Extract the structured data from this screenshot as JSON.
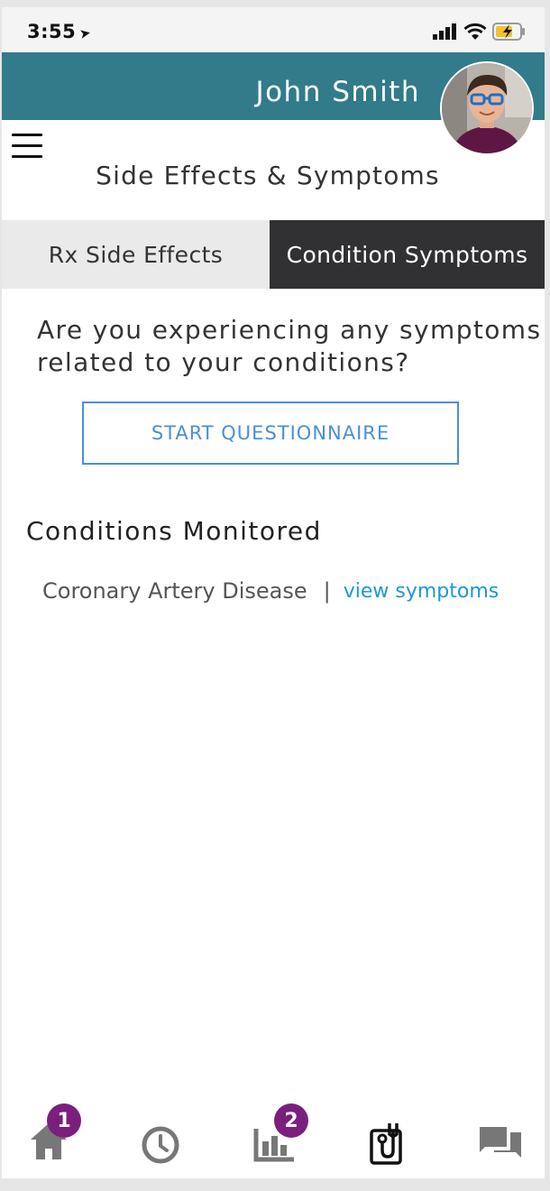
{
  "status_bar": {
    "time": "3:55"
  },
  "header": {
    "user_name": "John Smith"
  },
  "page": {
    "title": "Side Effects & Symptoms"
  },
  "tabs": [
    {
      "label": "Rx Side Effects",
      "active": false
    },
    {
      "label": "Condition Symptoms",
      "active": true
    }
  ],
  "main": {
    "question": "Are you experiencing any symptoms related to your conditions?",
    "start_button_label": "START QUESTIONNAIRE",
    "section_heading": "Conditions Monitored",
    "conditions": [
      {
        "name": "Coronary Artery Disease",
        "separator": "|",
        "link_label": "view symptoms"
      }
    ]
  },
  "bottom_nav": {
    "items": [
      {
        "icon": "home-icon",
        "badge": "1"
      },
      {
        "icon": "clock-icon",
        "badge": ""
      },
      {
        "icon": "bar-chart-icon",
        "badge": "2"
      },
      {
        "icon": "stethoscope-icon",
        "badge": "",
        "active": true
      },
      {
        "icon": "chat-icon",
        "badge": ""
      }
    ]
  },
  "colors": {
    "header": "#317b8b",
    "active_tab": "#313134",
    "button_outline": "#4a8fd8",
    "link": "#1a99d6",
    "badge": "#7a1f7e"
  }
}
